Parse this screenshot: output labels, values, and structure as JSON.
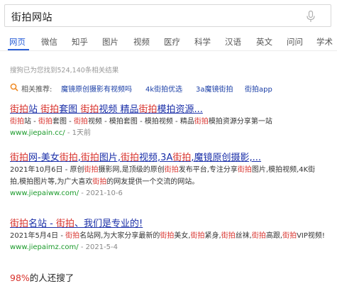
{
  "search": {
    "query": "街拍网站"
  },
  "tabs": [
    "网页",
    "微信",
    "知乎",
    "图片",
    "视频",
    "医疗",
    "科学",
    "汉语",
    "英文",
    "问问",
    "学术"
  ],
  "active_tab": "网页",
  "result_count": "搜狗已为您找到524,140条相关结果",
  "related": {
    "label": "相关推荐:",
    "links": [
      "魔镜原创摄影有视频吗",
      "4k街拍优选",
      "3a魔镜街拍",
      "街拍app"
    ]
  },
  "results": [
    {
      "title": "街拍站 街拍套图 街拍视频 精品街拍模拍资源...",
      "snippet": [
        "街拍站 - 街拍套图 - 街拍视频 - 模拍套图 - 模拍视频 - 精品街拍模拍资源分享第一站"
      ],
      "url": "www.jiepain.cc/",
      "date": "1天前"
    },
    {
      "title": "街拍网-美女街拍,街拍图片,街拍视频,3A街拍,魔镜原创摄影,...",
      "snippet": [
        "2021年10月6日 - 原创街拍摄影网,是顶级的原创街拍发布平台,专注分享街拍图片,模拍视频,4K街",
        "拍,模拍图片等,为广大喜欢街拍的网友提供一个交流的网站。"
      ],
      "url": "www.jiepaiww.com/",
      "date": "2021-10-6"
    },
    {
      "title": "街拍名站 - 街拍、我们是专业的!",
      "snippet": [
        "2021年5月4日 - 街拍名站网,为大家分享最新的街拍美女,街拍紧身,街拍丝袜,街拍高跟,街拍VIP视频!"
      ],
      "url": "www.jiepaimz.com/",
      "date": "2021-5-4"
    }
  ],
  "also_searched": {
    "percent": "98%",
    "text": "的人还搜了"
  },
  "colors": {
    "accent": "#2b60d8",
    "link": "#1a2fa8",
    "url": "#1a9a2a",
    "highlight": "#d8322c"
  }
}
